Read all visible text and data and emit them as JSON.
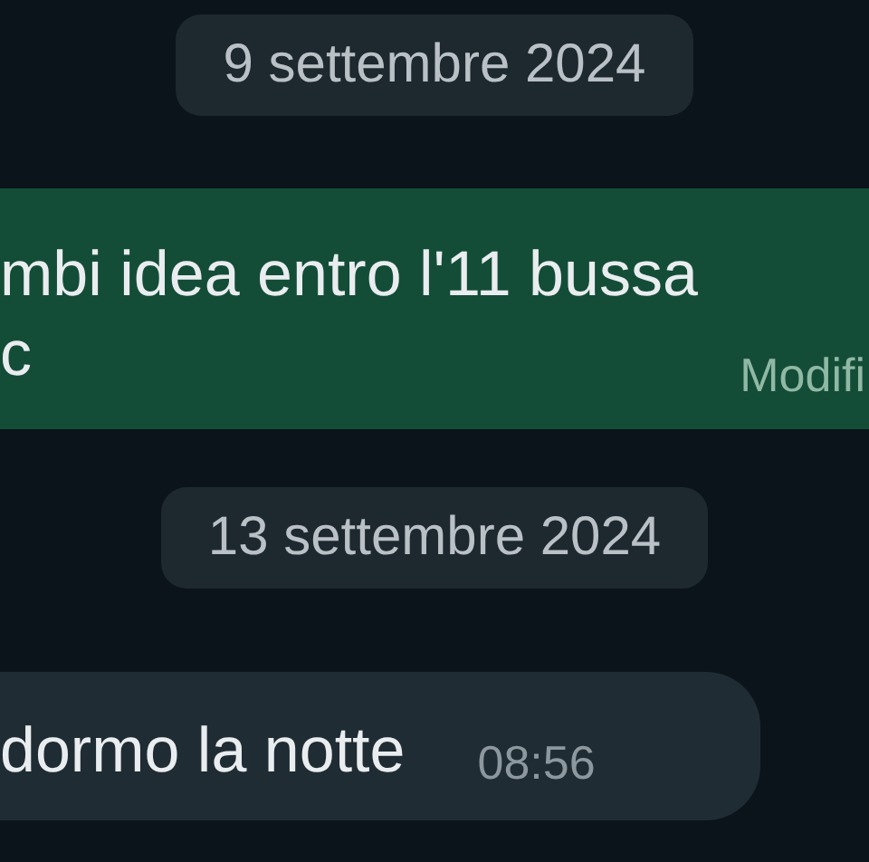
{
  "messages": [
    {
      "kind": "date",
      "text": "9 settembre 2024"
    },
    {
      "kind": "outgoing",
      "lines": [
        "mbi idea entro l'11 bussa",
        "c"
      ],
      "meta": "Modifi"
    },
    {
      "kind": "date",
      "text": "13 settembre 2024"
    },
    {
      "kind": "incoming",
      "lines": [
        "dormo la notte"
      ],
      "meta": "08:56"
    }
  ]
}
